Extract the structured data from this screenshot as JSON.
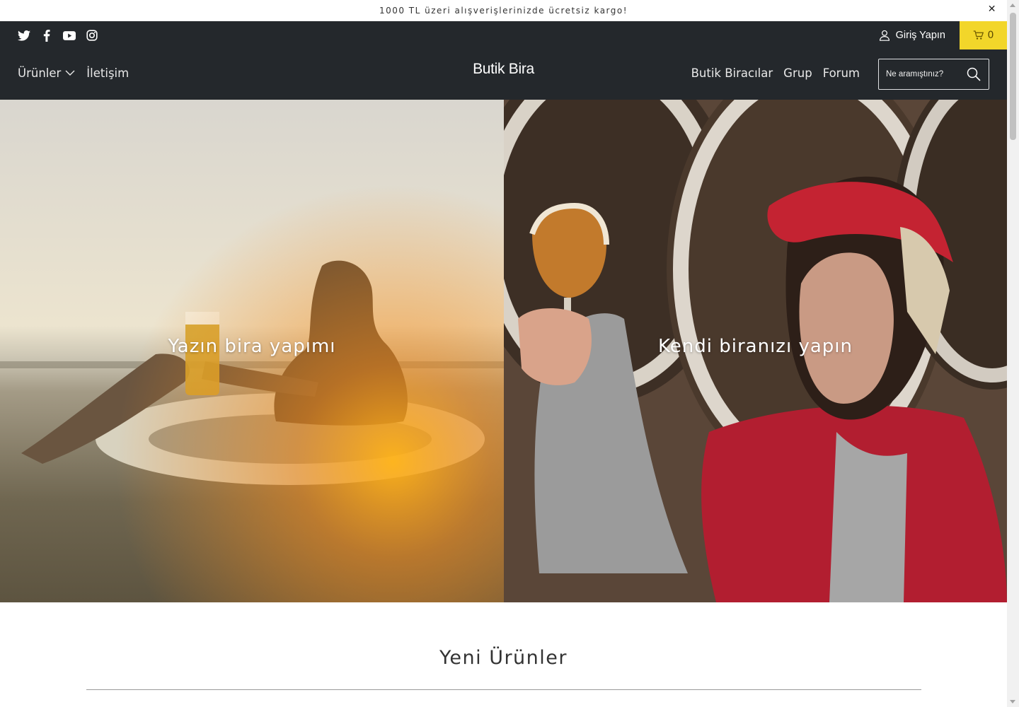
{
  "announcement": {
    "text": "1000 TL üzeri alışverişlerinizde ücretsiz kargo!",
    "close": "✕"
  },
  "social": [
    {
      "icon": "twitter-icon"
    },
    {
      "icon": "facebook-icon"
    },
    {
      "icon": "youtube-icon"
    },
    {
      "icon": "instagram-icon"
    }
  ],
  "account": {
    "login_label": "Giriş Yapın",
    "cart_count": "0",
    "cart_color": "#f2d62a"
  },
  "nav": {
    "brand": "Butik Bira",
    "left": [
      {
        "label": "Ürünler"
      },
      {
        "label": "İletişim"
      }
    ],
    "right": [
      {
        "label": "Butik Biracılar"
      },
      {
        "label": "Grup"
      },
      {
        "label": "Forum"
      }
    ],
    "search_placeholder": "Ne aramıştınız?",
    "bg_color": "#24282c"
  },
  "hero": [
    {
      "caption": "Yazın bira yapımı"
    },
    {
      "caption": "Kendi biranızı yapın"
    }
  ],
  "section": {
    "title": "Yeni Ürünler"
  }
}
